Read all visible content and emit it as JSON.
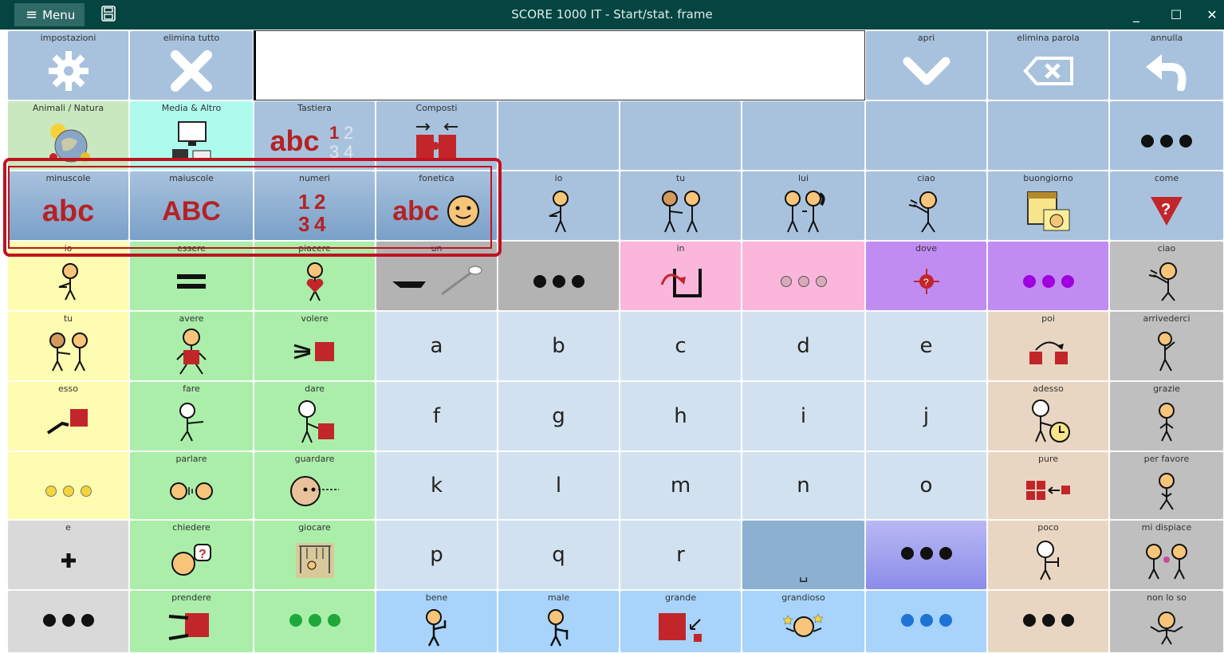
{
  "titlebar": {
    "menu_label": "Menu",
    "title": "SCORE 1000 IT - Start/stat. frame"
  },
  "top_row": {
    "settings": "impostazioni",
    "clear_all": "elimina tutto",
    "open": "apri",
    "delete_word": "elimina parola",
    "undo": "annulla"
  },
  "categories": {
    "animals": "Animali / Natura",
    "media": "Media & Altro",
    "keyboard": "Tastiera",
    "compounds": "Composti"
  },
  "keyboard_modes": {
    "lowercase": "minuscole",
    "uppercase": "maiuscole",
    "numbers": "numeri",
    "phonetic": "fonetica",
    "abc_lower": "abc",
    "abc_upper": "ABC"
  },
  "quick": {
    "io": "io",
    "tu": "tu",
    "lui": "lui",
    "ciao": "ciao",
    "buongiorno": "buongiorno",
    "come": "come"
  },
  "words": {
    "io": "io",
    "essere": "essere",
    "piacere": "piacere",
    "un": "un",
    "in": "in",
    "dove": "dove",
    "ciao": "ciao",
    "tu": "tu",
    "avere": "avere",
    "volere": "volere",
    "poi": "poi",
    "arrivederci": "arrivederci",
    "esso": "esso",
    "fare": "fare",
    "dare": "dare",
    "adesso": "adesso",
    "grazie": "grazie",
    "parlare": "parlare",
    "guardare": "guardare",
    "pure": "pure",
    "per_favore": "per favore",
    "e": "e",
    "chiedere": "chiedere",
    "giocare": "giocare",
    "poco": "poco",
    "mi_dispiace": "mi dispiace",
    "prendere": "prendere",
    "bene": "bene",
    "male": "male",
    "grande": "grande",
    "grandioso": "grandioso",
    "non_lo_so": "non lo so"
  },
  "letters": {
    "a": "a",
    "b": "b",
    "c": "c",
    "d": "d",
    "e": "e",
    "f": "f",
    "g": "g",
    "h": "h",
    "i": "i",
    "j": "j",
    "k": "k",
    "l": "l",
    "m": "m",
    "n": "n",
    "o": "o",
    "p": "p",
    "q": "q",
    "r": "r",
    "space": "␣"
  },
  "colors": {
    "title_bg": "#044541",
    "blue": "#a8c2de",
    "yellow": "#fdfcb0",
    "green": "#aaeeaa",
    "light_blue": "#d2e1ef",
    "tan": "#e9d6c2",
    "grey": "#cfcfcf",
    "pink": "#fbb6dc",
    "purple": "#c08cf2",
    "sky": "#a8d3fa",
    "highlight": "#c1121f"
  }
}
